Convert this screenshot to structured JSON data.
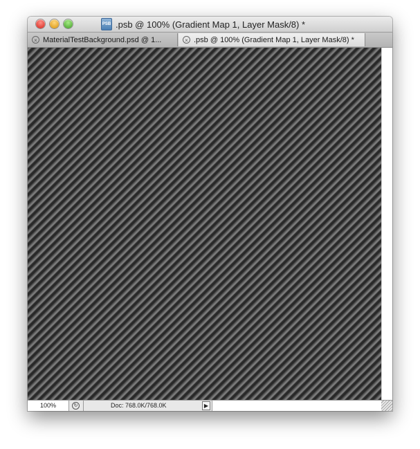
{
  "window": {
    "title": ".psb @ 100% (Gradient Map 1, Layer Mask/8) *",
    "doc_icon_label": "PSB"
  },
  "tabs": [
    {
      "label": "MaterialTestBackground.psd @ 1...",
      "active": false
    },
    {
      "label": ".psb @ 100% (Gradient Map 1, Layer Mask/8) *",
      "active": true
    }
  ],
  "status": {
    "zoom": "100%",
    "doc_info": "Doc: 768.0K/768.0K",
    "menu_arrow": "▶"
  },
  "icons": {
    "close": "close-button",
    "minimize": "minimize-button",
    "zoom": "zoom-button",
    "tab_close": "×",
    "status_icon": "↻"
  },
  "colors": {
    "close": "#d3231a",
    "minimize": "#d7930c",
    "zoom": "#3f9c23"
  }
}
